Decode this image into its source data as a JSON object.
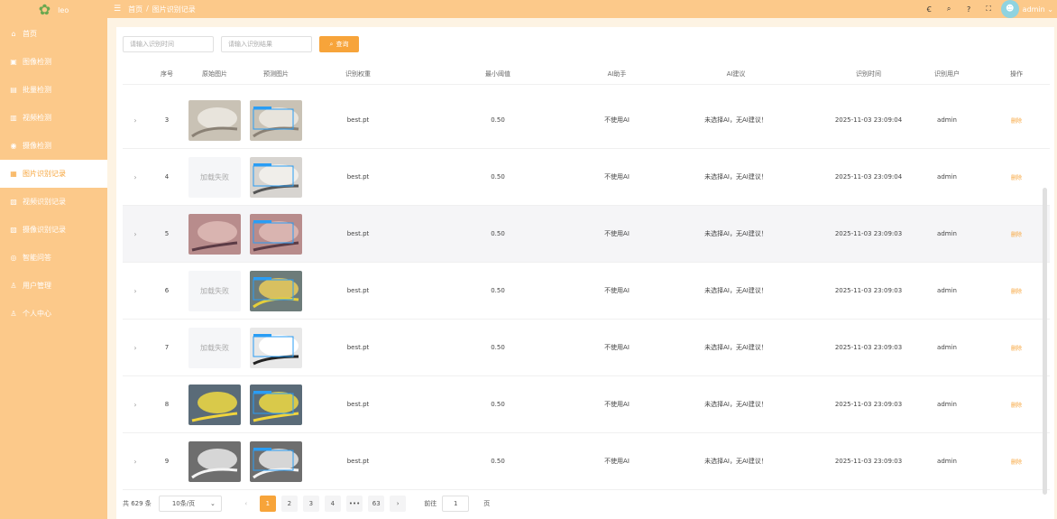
{
  "app": {
    "logo_text": "leo"
  },
  "sidebar": {
    "items": [
      {
        "label": "首页",
        "icon": "⌂"
      },
      {
        "label": "图像检测",
        "icon": "▣"
      },
      {
        "label": "批量检测",
        "icon": "▤"
      },
      {
        "label": "视频检测",
        "icon": "▥"
      },
      {
        "label": "摄像检测",
        "icon": "◉"
      },
      {
        "label": "图片识别记录",
        "icon": "▦"
      },
      {
        "label": "视频识别记录",
        "icon": "▧"
      },
      {
        "label": "摄像识别记录",
        "icon": "▨"
      },
      {
        "label": "智能问答",
        "icon": "◎"
      },
      {
        "label": "用户管理",
        "icon": "♙"
      },
      {
        "label": "个人中心",
        "icon": "♙"
      }
    ]
  },
  "header": {
    "breadcrumb_home": "首页",
    "breadcrumb_sep": "/",
    "breadcrumb_current": "图片识别记录",
    "username": "admin"
  },
  "search": {
    "time_placeholder": "请输入识别时间",
    "result_placeholder": "请输入识别结果",
    "button_label": "查询"
  },
  "table": {
    "headers": [
      "序号",
      "原始图片",
      "预测图片",
      "识别权重",
      "最小阈值",
      "AI助手",
      "AI建议",
      "识别时间",
      "识别用户",
      "操作"
    ],
    "load_fail_text": "加载失败",
    "delete_label": "删除",
    "rows": [
      {
        "index": "3",
        "orig": "img",
        "pred": "img",
        "weight": "best.pt",
        "threshold": "0.50",
        "ai": "不使用AI",
        "suggestion": "未选择AI，无AI建议！",
        "time": "2025-11-03 23:09:04",
        "user": "admin"
      },
      {
        "index": "4",
        "orig": "fail",
        "pred": "img",
        "weight": "best.pt",
        "threshold": "0.50",
        "ai": "不使用AI",
        "suggestion": "未选择AI，无AI建议！",
        "time": "2025-11-03 23:09:04",
        "user": "admin"
      },
      {
        "index": "5",
        "orig": "img",
        "pred": "img",
        "weight": "best.pt",
        "threshold": "0.50",
        "ai": "不使用AI",
        "suggestion": "未选择AI，无AI建议！",
        "time": "2025-11-03 23:09:03",
        "user": "admin"
      },
      {
        "index": "6",
        "orig": "fail",
        "pred": "img",
        "weight": "best.pt",
        "threshold": "0.50",
        "ai": "不使用AI",
        "suggestion": "未选择AI，无AI建议！",
        "time": "2025-11-03 23:09:03",
        "user": "admin"
      },
      {
        "index": "7",
        "orig": "fail",
        "pred": "img",
        "weight": "best.pt",
        "threshold": "0.50",
        "ai": "不使用AI",
        "suggestion": "未选择AI，无AI建议！",
        "time": "2025-11-03 23:09:03",
        "user": "admin"
      },
      {
        "index": "8",
        "orig": "img",
        "pred": "img",
        "weight": "best.pt",
        "threshold": "0.50",
        "ai": "不使用AI",
        "suggestion": "未选择AI，无AI建议！",
        "time": "2025-11-03 23:09:03",
        "user": "admin"
      },
      {
        "index": "9",
        "orig": "img",
        "pred": "img",
        "weight": "best.pt",
        "threshold": "0.50",
        "ai": "不使用AI",
        "suggestion": "未选择AI，无AI建议！",
        "time": "2025-11-03 23:09:03",
        "user": "admin"
      }
    ]
  },
  "pagination": {
    "total": "共 629 条",
    "page_size": "10条/页",
    "prev": "‹",
    "pages": [
      "1",
      "2",
      "3",
      "4",
      "•••",
      "63"
    ],
    "active_page": "1",
    "next": "›",
    "goto_label": "前往",
    "goto_value": "1",
    "goto_suffix": "页"
  },
  "colors": {
    "accent": "#f7a43a",
    "sidebar": "#fcc98a",
    "background": "#fdf3e3"
  }
}
